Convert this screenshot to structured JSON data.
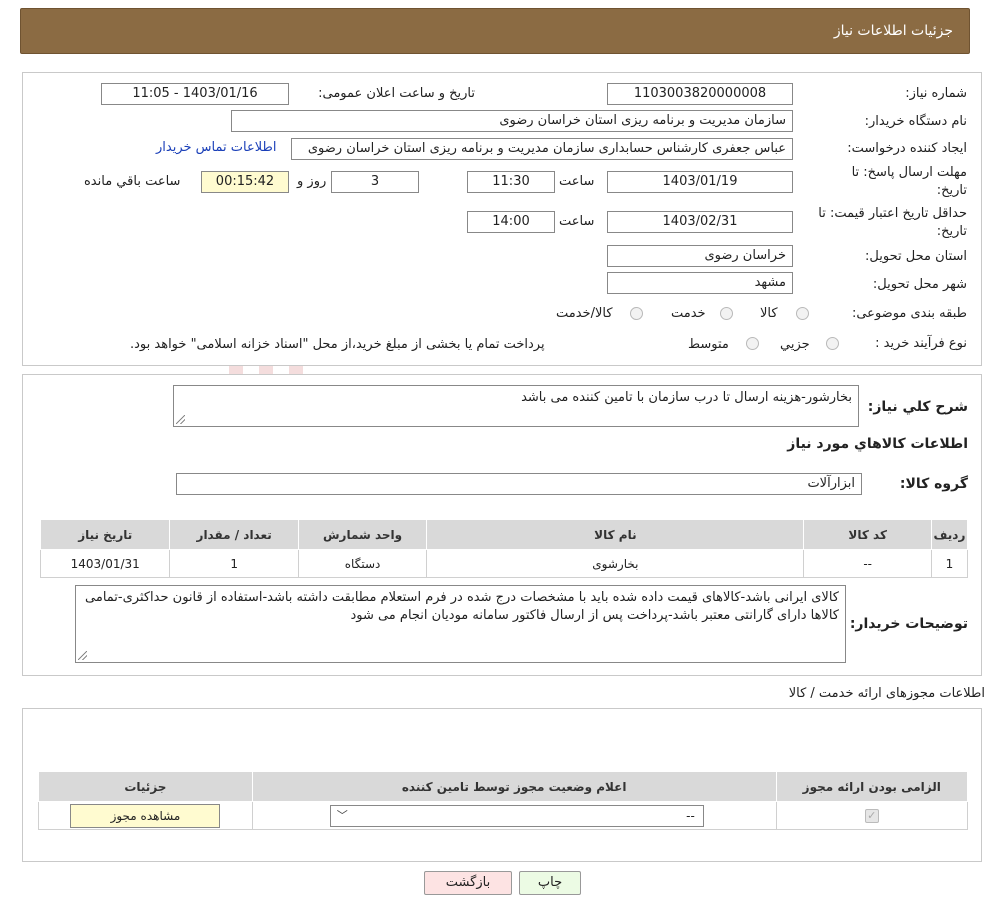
{
  "header": {
    "title": "جزئیات اطلاعات نیاز"
  },
  "form": {
    "need_number_label": "شماره نیاز:",
    "need_number": "1103003820000008",
    "announce_label": "تاریخ و ساعت اعلان عمومی:",
    "announce_value": "1403/01/16 - 11:05",
    "buyer_org_label": "نام دستگاه خریدار:",
    "buyer_org": "سازمان مدیریت و برنامه ریزی استان خراسان رضوی",
    "creator_label": "ایجاد کننده درخواست:",
    "creator": "عباس جعفری کارشناس حسابداری سازمان مدیریت و برنامه ریزی استان خراسان رضوی",
    "contact_link": "اطلاعات تماس خریدار",
    "deadline_label_1": "مهلت ارسال پاسخ: تا",
    "deadline_label_2": "تاریخ:",
    "deadline_date": "1403/01/19",
    "time_word": "ساعت",
    "deadline_time": "11:30",
    "days_value": "3",
    "days_word": "روز و",
    "remaining_time": "00:15:42",
    "remaining_word": "ساعت باقي مانده",
    "validity_label_1": "حداقل تاریخ اعتبار قیمت: تا",
    "validity_label_2": "تاریخ:",
    "validity_date": "1403/02/31",
    "validity_time": "14:00",
    "province_label": "استان محل تحویل:",
    "province": "خراسان رضوی",
    "city_label": "شهر محل تحویل:",
    "city": "مشهد",
    "category_label": "طبقه بندی موضوعی:",
    "category_options": [
      "کالا",
      "خدمت",
      "کالا/خدمت"
    ],
    "process_label": "نوع فرآیند خرید :",
    "process_options": [
      "جزیي",
      "متوسط"
    ],
    "process_note": "پرداخت تمام یا بخشی از مبلغ خرید،از محل \"اسناد خزانه اسلامی\" خواهد بود."
  },
  "details": {
    "summary_label": "شرح کلي نياز:",
    "summary_text": "بخارشور-هزینه ارسال تا درب سازمان با تامین کننده می باشد",
    "goods_title": "اطلاعات کالاهاي مورد نياز",
    "group_label": "گروه کالا:",
    "group_value": "ابزارآلات",
    "table_headers": [
      "رديف",
      "کد کالا",
      "نام کالا",
      "واحد شمارش",
      "تعداد / مقدار",
      "تاریخ نیاز"
    ],
    "table_rows": [
      [
        "1",
        "--",
        "بخارشوی",
        "دستگاه",
        "1",
        "1403/01/31"
      ]
    ],
    "buyer_notes_label": "توضیحات خریدار:",
    "buyer_notes": "کالای ایرانی باشد-کالاهای قیمت داده شده باید با مشخصات درج شده در فرم استعلام مطابقت داشته باشد-استفاده از قانون حداکثری-تمامی کالاها دارای گارانتی معتبر باشد-پرداخت پس از ارسال فاکتور سامانه مودیان انجام می شود"
  },
  "permits": {
    "title": "اطلاعات مجوزهای ارائه خدمت / کالا",
    "headers": [
      "الزامی بودن ارائه مجوز",
      "اعلام وضعیت مجوز توسط تامین کننده",
      "جزئیات"
    ],
    "select_value": "--",
    "view_button": "مشاهده مجوز"
  },
  "actions": {
    "print": "چاپ",
    "back": "بازگشت"
  },
  "watermark": {
    "text": "AriaTender.neT"
  },
  "colors": {
    "header": "#8b6b43",
    "link": "#1a3fb8",
    "back_button": "#fde3e3",
    "print_button": "#ecfbe4",
    "highlight": "#fffbd0"
  }
}
